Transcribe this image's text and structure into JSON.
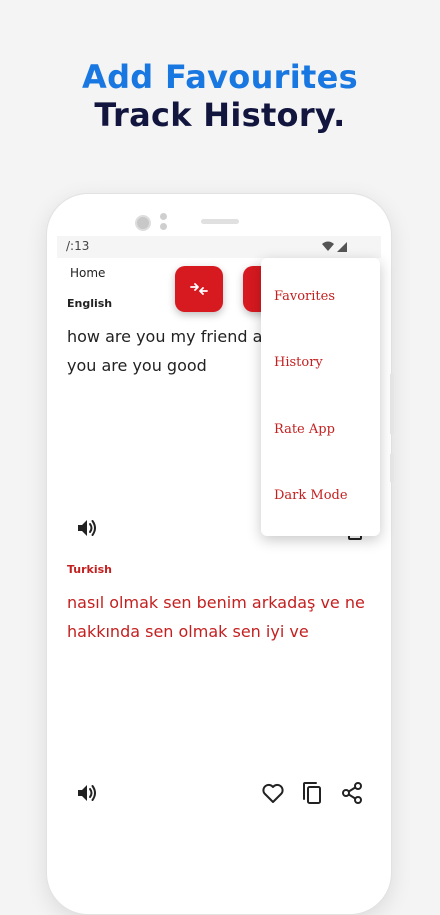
{
  "promo": {
    "line1": "Add Favourites",
    "line2": "Track History."
  },
  "status_bar": {
    "time": "/:13",
    "icons": [
      "wifi-icon",
      "signal-icon"
    ]
  },
  "app_bar": {
    "title": "Home",
    "swap_button_icon": "swap-arrows-icon"
  },
  "source": {
    "language": "English",
    "text": "how are you my friend and what about you are you good",
    "icons": [
      "speaker-icon"
    ]
  },
  "target": {
    "language": "Turkish",
    "text": "nasıl olmak sen benim arkadaş ve ne hakkında sen olmak sen iyi ve",
    "icons": [
      "speaker-icon",
      "heart-icon",
      "copy-icon",
      "share-icon"
    ]
  },
  "menu": {
    "items": [
      "Favorites",
      "History",
      "Rate App",
      "Dark Mode"
    ]
  },
  "colors": {
    "accent_red": "#d71920",
    "text_red": "#c41f1f",
    "headline_blue": "#1877e0",
    "headline_navy": "#12163f"
  }
}
